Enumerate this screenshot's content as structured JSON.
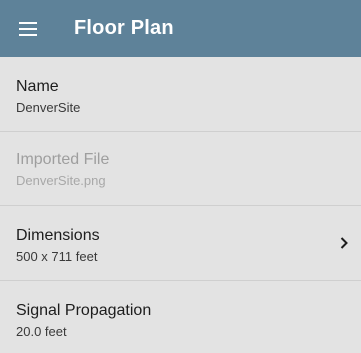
{
  "appbar": {
    "title": "Floor Plan",
    "menu_icon": "hamburger-menu-icon",
    "background": "#5e8299"
  },
  "rows": [
    {
      "label": "Name",
      "value": "DenverSite",
      "enabled": true
    },
    {
      "label": "Imported File",
      "value": "DenverSite.png",
      "enabled": false
    },
    {
      "label": "Dimensions",
      "value": "500 x 711 feet",
      "enabled": true,
      "trailing_icon": "chevron-right-icon"
    },
    {
      "label": "Signal Propagation",
      "value": "20.0 feet",
      "enabled": true
    }
  ]
}
